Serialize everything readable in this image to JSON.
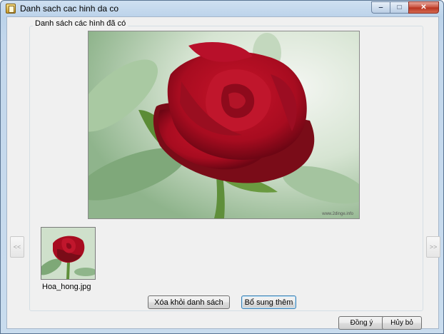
{
  "window": {
    "title": "Danh sach cac hinh da co"
  },
  "gallery": {
    "group_label": "Danh sách các hình đã có",
    "preview_watermark": "www.2dinge.info",
    "prev_label": "<<",
    "next_label": ">>",
    "thumbnails": [
      {
        "filename": "Hoa_hong.jpg"
      }
    ],
    "remove_label": "Xóa khỏi danh sách",
    "add_label": "Bổ sung thêm"
  },
  "footer": {
    "ok_label": "Đồng ý",
    "cancel_label": "Hủy bỏ"
  },
  "icons": {
    "app": "picture-list-icon",
    "minimize": "minimize-icon",
    "maximize": "maximize-icon",
    "close": "close-icon"
  },
  "colors": {
    "titlebar": "#c3d7ec",
    "client_bg": "#f0f0f0",
    "close_button": "#c74e3a",
    "default_button_border": "#3c7fb1"
  }
}
